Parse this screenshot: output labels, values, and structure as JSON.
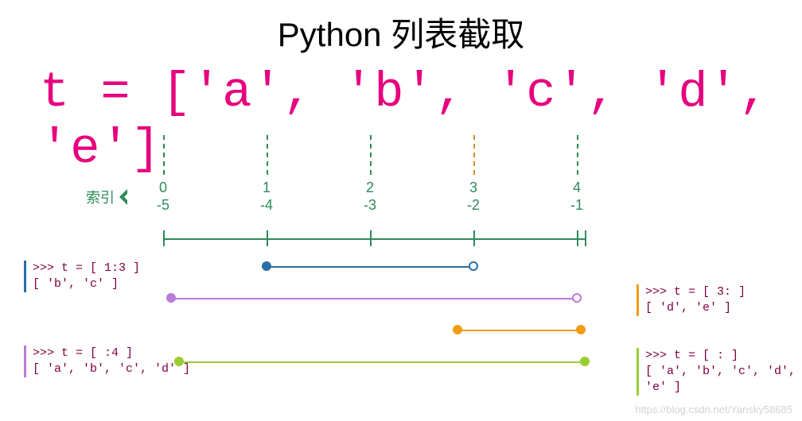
{
  "title": "Python 列表截取",
  "expression": "t = ['a', 'b', 'c', 'd', 'e']",
  "indexLabel": "索引",
  "indices": {
    "positive": [
      "0",
      "1",
      "2",
      "3",
      "4"
    ],
    "negative": [
      "-5",
      "-4",
      "-3",
      "-2",
      "-1"
    ]
  },
  "examples": {
    "e1": {
      "code": ">>> t = [ 1:3 ]",
      "result": "[ 'b', 'c' ]"
    },
    "e2": {
      "code": ">>> t = [ :4 ]",
      "result": "[ 'a', 'b', 'c', 'd' ]"
    },
    "e3": {
      "code": ">>> t = [ 3: ]",
      "result": "[ 'd', 'e' ]"
    },
    "e4": {
      "code": ">>> t = [ : ]",
      "result": "[ 'a', 'b', 'c', 'd', 'e' ]"
    }
  },
  "watermark": "https://blog.csdn.net/Yansky58685",
  "chart_data": {
    "type": "table",
    "title": "Python list slicing",
    "list": [
      "a",
      "b",
      "c",
      "d",
      "e"
    ],
    "pos_idx": [
      0,
      1,
      2,
      3,
      4
    ],
    "neg_idx": [
      -5,
      -4,
      -3,
      -2,
      -1
    ],
    "ranges": [
      {
        "slice": "[1:3]",
        "start": 1,
        "end": 3,
        "end_open": true,
        "color": "blue",
        "result": [
          "b",
          "c"
        ]
      },
      {
        "slice": "[:4]",
        "start": 0,
        "end": 4,
        "end_open": true,
        "color": "purple",
        "result": [
          "a",
          "b",
          "c",
          "d"
        ]
      },
      {
        "slice": "[3:]",
        "start": 3,
        "end": 4,
        "end_open": false,
        "color": "orange",
        "result": [
          "d",
          "e"
        ]
      },
      {
        "slice": "[:]",
        "start": 0,
        "end": 4,
        "end_open": false,
        "color": "lime",
        "result": [
          "a",
          "b",
          "c",
          "d",
          "e"
        ]
      }
    ]
  }
}
